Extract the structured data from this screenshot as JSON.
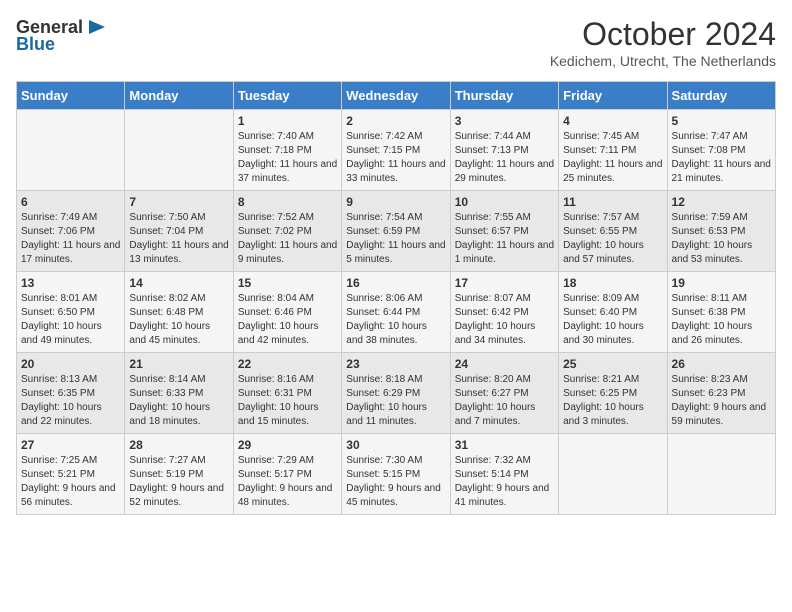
{
  "header": {
    "logo_general": "General",
    "logo_blue": "Blue",
    "title": "October 2024",
    "location": "Kedichem, Utrecht, The Netherlands"
  },
  "days_of_week": [
    "Sunday",
    "Monday",
    "Tuesday",
    "Wednesday",
    "Thursday",
    "Friday",
    "Saturday"
  ],
  "weeks": [
    [
      {
        "day": "",
        "content": ""
      },
      {
        "day": "",
        "content": ""
      },
      {
        "day": "1",
        "content": "Sunrise: 7:40 AM\nSunset: 7:18 PM\nDaylight: 11 hours and 37 minutes."
      },
      {
        "day": "2",
        "content": "Sunrise: 7:42 AM\nSunset: 7:15 PM\nDaylight: 11 hours and 33 minutes."
      },
      {
        "day": "3",
        "content": "Sunrise: 7:44 AM\nSunset: 7:13 PM\nDaylight: 11 hours and 29 minutes."
      },
      {
        "day": "4",
        "content": "Sunrise: 7:45 AM\nSunset: 7:11 PM\nDaylight: 11 hours and 25 minutes."
      },
      {
        "day": "5",
        "content": "Sunrise: 7:47 AM\nSunset: 7:08 PM\nDaylight: 11 hours and 21 minutes."
      }
    ],
    [
      {
        "day": "6",
        "content": "Sunrise: 7:49 AM\nSunset: 7:06 PM\nDaylight: 11 hours and 17 minutes."
      },
      {
        "day": "7",
        "content": "Sunrise: 7:50 AM\nSunset: 7:04 PM\nDaylight: 11 hours and 13 minutes."
      },
      {
        "day": "8",
        "content": "Sunrise: 7:52 AM\nSunset: 7:02 PM\nDaylight: 11 hours and 9 minutes."
      },
      {
        "day": "9",
        "content": "Sunrise: 7:54 AM\nSunset: 6:59 PM\nDaylight: 11 hours and 5 minutes."
      },
      {
        "day": "10",
        "content": "Sunrise: 7:55 AM\nSunset: 6:57 PM\nDaylight: 11 hours and 1 minute."
      },
      {
        "day": "11",
        "content": "Sunrise: 7:57 AM\nSunset: 6:55 PM\nDaylight: 10 hours and 57 minutes."
      },
      {
        "day": "12",
        "content": "Sunrise: 7:59 AM\nSunset: 6:53 PM\nDaylight: 10 hours and 53 minutes."
      }
    ],
    [
      {
        "day": "13",
        "content": "Sunrise: 8:01 AM\nSunset: 6:50 PM\nDaylight: 10 hours and 49 minutes."
      },
      {
        "day": "14",
        "content": "Sunrise: 8:02 AM\nSunset: 6:48 PM\nDaylight: 10 hours and 45 minutes."
      },
      {
        "day": "15",
        "content": "Sunrise: 8:04 AM\nSunset: 6:46 PM\nDaylight: 10 hours and 42 minutes."
      },
      {
        "day": "16",
        "content": "Sunrise: 8:06 AM\nSunset: 6:44 PM\nDaylight: 10 hours and 38 minutes."
      },
      {
        "day": "17",
        "content": "Sunrise: 8:07 AM\nSunset: 6:42 PM\nDaylight: 10 hours and 34 minutes."
      },
      {
        "day": "18",
        "content": "Sunrise: 8:09 AM\nSunset: 6:40 PM\nDaylight: 10 hours and 30 minutes."
      },
      {
        "day": "19",
        "content": "Sunrise: 8:11 AM\nSunset: 6:38 PM\nDaylight: 10 hours and 26 minutes."
      }
    ],
    [
      {
        "day": "20",
        "content": "Sunrise: 8:13 AM\nSunset: 6:35 PM\nDaylight: 10 hours and 22 minutes."
      },
      {
        "day": "21",
        "content": "Sunrise: 8:14 AM\nSunset: 6:33 PM\nDaylight: 10 hours and 18 minutes."
      },
      {
        "day": "22",
        "content": "Sunrise: 8:16 AM\nSunset: 6:31 PM\nDaylight: 10 hours and 15 minutes."
      },
      {
        "day": "23",
        "content": "Sunrise: 8:18 AM\nSunset: 6:29 PM\nDaylight: 10 hours and 11 minutes."
      },
      {
        "day": "24",
        "content": "Sunrise: 8:20 AM\nSunset: 6:27 PM\nDaylight: 10 hours and 7 minutes."
      },
      {
        "day": "25",
        "content": "Sunrise: 8:21 AM\nSunset: 6:25 PM\nDaylight: 10 hours and 3 minutes."
      },
      {
        "day": "26",
        "content": "Sunrise: 8:23 AM\nSunset: 6:23 PM\nDaylight: 9 hours and 59 minutes."
      }
    ],
    [
      {
        "day": "27",
        "content": "Sunrise: 7:25 AM\nSunset: 5:21 PM\nDaylight: 9 hours and 56 minutes."
      },
      {
        "day": "28",
        "content": "Sunrise: 7:27 AM\nSunset: 5:19 PM\nDaylight: 9 hours and 52 minutes."
      },
      {
        "day": "29",
        "content": "Sunrise: 7:29 AM\nSunset: 5:17 PM\nDaylight: 9 hours and 48 minutes."
      },
      {
        "day": "30",
        "content": "Sunrise: 7:30 AM\nSunset: 5:15 PM\nDaylight: 9 hours and 45 minutes."
      },
      {
        "day": "31",
        "content": "Sunrise: 7:32 AM\nSunset: 5:14 PM\nDaylight: 9 hours and 41 minutes."
      },
      {
        "day": "",
        "content": ""
      },
      {
        "day": "",
        "content": ""
      }
    ]
  ]
}
